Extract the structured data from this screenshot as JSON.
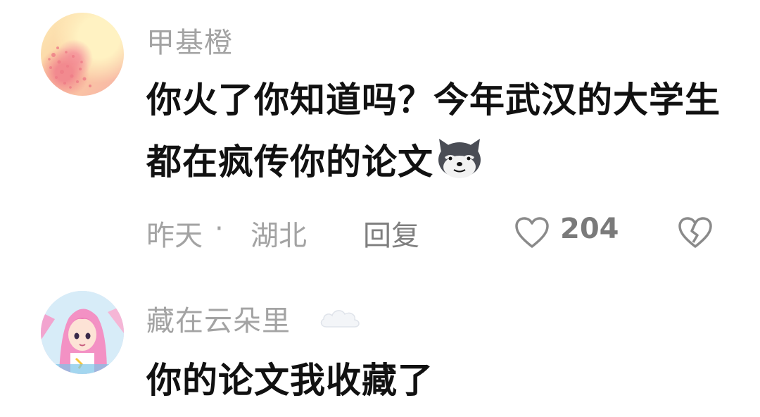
{
  "comments": [
    {
      "username": "甲基橙",
      "content": "你火了你知道吗？今年武汉的大学生都在疯传你的论文",
      "time": "昨天",
      "separator": "·",
      "location": "湖北",
      "reply_label": "回复",
      "likes": "204"
    },
    {
      "username": "藏在云朵里",
      "content": "你的论文我收藏了"
    }
  ]
}
